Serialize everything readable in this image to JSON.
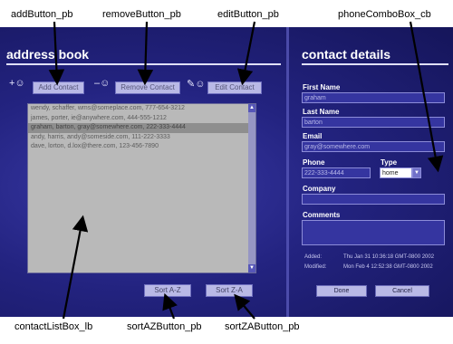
{
  "annotations": {
    "add": "addButton_pb",
    "remove": "removeButton_pb",
    "edit": "editButton_pb",
    "phone_combo": "phoneComboBox_cb",
    "list": "contactListBox_lb",
    "sort_az": "sortAZButton_pb",
    "sort_za": "sortZAButton_pb"
  },
  "address_book": {
    "title": "address book",
    "add_label": "Add Contact",
    "remove_label": "Remove Contact",
    "edit_label": "Edit Contact",
    "contacts": [
      "wendy, schaffer, wms@someplace.com, 777-654-3212",
      "james, porter, ie@anywhere.com, 444-555-1212",
      "graham, barton, gray@somewhere.com, 222-333-4444",
      "andy, harris, andy@someside.com, 111-222-3333",
      "dave, lorton, d.lox@there.com, 123-456-7890"
    ],
    "selected_index": 2,
    "sort_az_label": "Sort A-Z",
    "sort_za_label": "Sort Z-A"
  },
  "contact_details": {
    "title": "contact details",
    "first_name_label": "First Name",
    "first_name": "graham",
    "last_name_label": "Last Name",
    "last_name": "barton",
    "email_label": "Email",
    "email": "gray@somewhere.com",
    "phone_label": "Phone",
    "phone": "222-333-4444",
    "type_label": "Type",
    "type_value": "home",
    "company_label": "Company",
    "company": "",
    "comments_label": "Comments",
    "comments": "",
    "added_label": "Added:",
    "added_value": "Thu Jan 31 10:36:18 GMT-0800 2002",
    "modified_label": "Modified:",
    "modified_value": "Mon Feb 4 12:52:38 GMT-0800 2002",
    "done_label": "Done",
    "cancel_label": "Cancel"
  }
}
